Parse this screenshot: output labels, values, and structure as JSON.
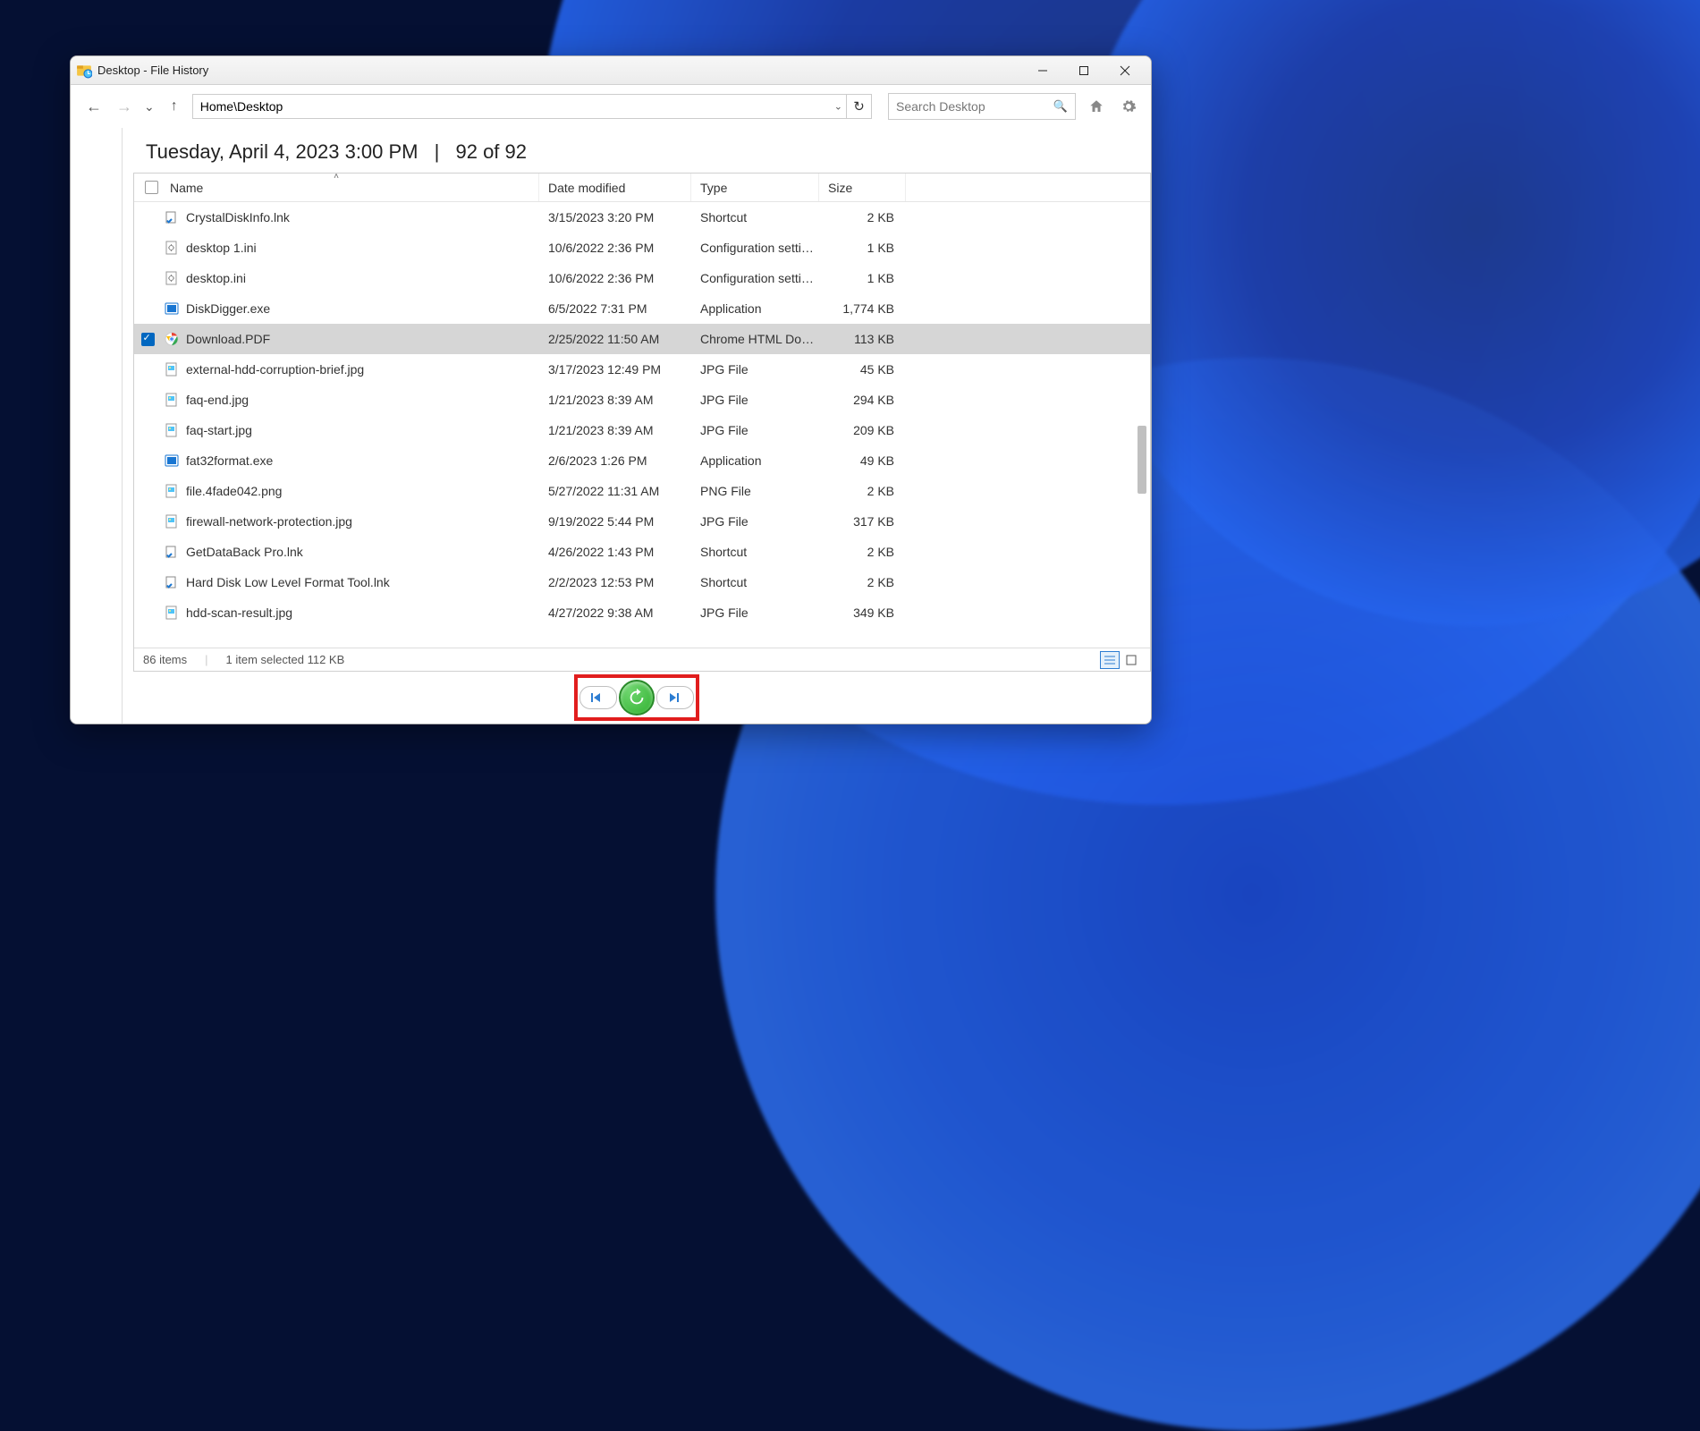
{
  "window": {
    "title": "Desktop - File History"
  },
  "toolbar": {
    "path": "Home\\Desktop",
    "search_placeholder": "Search Desktop"
  },
  "snapshot": {
    "timestamp_label": "Tuesday, April 4, 2023 3:00 PM",
    "position_label": "92 of 92"
  },
  "columns": {
    "name": "Name",
    "date": "Date modified",
    "type": "Type",
    "size": "Size"
  },
  "files": [
    {
      "name": "CrystalDiskInfo.lnk",
      "date": "3/15/2023 3:20 PM",
      "type": "Shortcut",
      "size": "2 KB",
      "icon": "lnk",
      "selected": false
    },
    {
      "name": "desktop 1.ini",
      "date": "10/6/2022 2:36 PM",
      "type": "Configuration settings",
      "size": "1 KB",
      "icon": "ini",
      "selected": false
    },
    {
      "name": "desktop.ini",
      "date": "10/6/2022 2:36 PM",
      "type": "Configuration settings",
      "size": "1 KB",
      "icon": "ini",
      "selected": false
    },
    {
      "name": "DiskDigger.exe",
      "date": "6/5/2022 7:31 PM",
      "type": "Application",
      "size": "1,774 KB",
      "icon": "exe-blue",
      "selected": false
    },
    {
      "name": "Download.PDF",
      "date": "2/25/2022 11:50 AM",
      "type": "Chrome HTML Docu...",
      "size": "113 KB",
      "icon": "chrome",
      "selected": true
    },
    {
      "name": "external-hdd-corruption-brief.jpg",
      "date": "3/17/2023 12:49 PM",
      "type": "JPG File",
      "size": "45 KB",
      "icon": "img",
      "selected": false
    },
    {
      "name": "faq-end.jpg",
      "date": "1/21/2023 8:39 AM",
      "type": "JPG File",
      "size": "294 KB",
      "icon": "img",
      "selected": false
    },
    {
      "name": "faq-start.jpg",
      "date": "1/21/2023 8:39 AM",
      "type": "JPG File",
      "size": "209 KB",
      "icon": "img",
      "selected": false
    },
    {
      "name": "fat32format.exe",
      "date": "2/6/2023 1:26 PM",
      "type": "Application",
      "size": "49 KB",
      "icon": "exe-blue",
      "selected": false
    },
    {
      "name": "file.4fade042.png",
      "date": "5/27/2022 11:31 AM",
      "type": "PNG File",
      "size": "2 KB",
      "icon": "img",
      "selected": false
    },
    {
      "name": "firewall-network-protection.jpg",
      "date": "9/19/2022 5:44 PM",
      "type": "JPG File",
      "size": "317 KB",
      "icon": "img",
      "selected": false
    },
    {
      "name": "GetDataBack Pro.lnk",
      "date": "4/26/2022 1:43 PM",
      "type": "Shortcut",
      "size": "2 KB",
      "icon": "lnk",
      "selected": false
    },
    {
      "name": "Hard Disk Low Level Format Tool.lnk",
      "date": "2/2/2023 12:53 PM",
      "type": "Shortcut",
      "size": "2 KB",
      "icon": "lnk",
      "selected": false
    },
    {
      "name": "hdd-scan-result.jpg",
      "date": "4/27/2022 9:38 AM",
      "type": "JPG File",
      "size": "349 KB",
      "icon": "img",
      "selected": false
    }
  ],
  "status": {
    "items_count": "86 items",
    "selected_info": "1 item selected  112 KB"
  }
}
